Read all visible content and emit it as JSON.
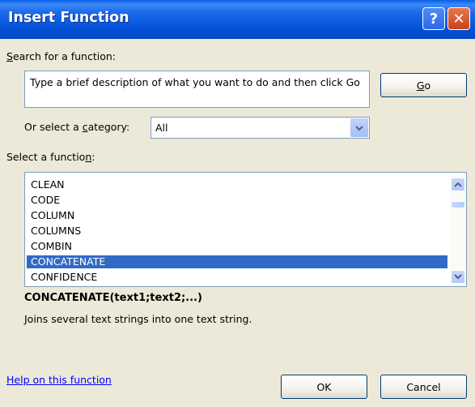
{
  "window": {
    "title": "Insert Function",
    "help_glyph": "?",
    "close_glyph": "✕"
  },
  "search": {
    "label_prefix": "S",
    "label_rest": "earch for a function:",
    "value": "Type a brief description of what you want to do and then click Go",
    "go_key": "G",
    "go_rest": "o"
  },
  "category": {
    "label_pre": "Or select a ",
    "label_key": "c",
    "label_post": "ategory:",
    "value": "All"
  },
  "function_list": {
    "label_pre": "Select a functio",
    "label_key": "n",
    "label_post": ":",
    "items": [
      "CLEAN",
      "CODE",
      "COLUMN",
      "COLUMNS",
      "COMBIN",
      "CONCATENATE",
      "CONFIDENCE"
    ],
    "selected_index": 5
  },
  "details": {
    "signature": "CONCATENATE(text1;text2;...)",
    "description": "Joins several text strings into one text string."
  },
  "footer": {
    "help_link": "Help on this function",
    "ok": "OK",
    "cancel": "Cancel"
  },
  "colors": {
    "title_bar": "#0453D9",
    "selection": "#316AC5",
    "dialog_bg": "#ECE9D8",
    "link": "#0000FF"
  }
}
